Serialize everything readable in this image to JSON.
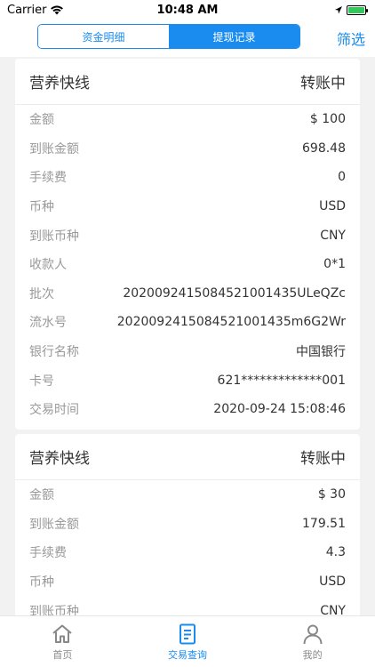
{
  "status_bar": {
    "carrier": "Carrier",
    "time": "10:48 AM"
  },
  "header": {
    "tabs": [
      {
        "label": "资金明细",
        "active": false
      },
      {
        "label": "提现记录",
        "active": true
      }
    ],
    "filter_label": "筛选"
  },
  "records": [
    {
      "title": "营养快线",
      "status": "转账中",
      "fields": [
        {
          "key": "金额",
          "value": "$ 100"
        },
        {
          "key": "到账金额",
          "value": "698.48"
        },
        {
          "key": "手续费",
          "value": "0"
        },
        {
          "key": "币种",
          "value": "USD"
        },
        {
          "key": "到账币种",
          "value": "CNY"
        },
        {
          "key": "收款人",
          "value": "0*1"
        },
        {
          "key": "批次",
          "value": "2020092415084521001435ULeQZc"
        },
        {
          "key": "流水号",
          "value": "2020092415084521001435m6G2Wr"
        },
        {
          "key": "银行名称",
          "value": "中国银行"
        },
        {
          "key": "卡号",
          "value": "621*************001"
        },
        {
          "key": "交易时间",
          "value": "2020-09-24 15:08:46"
        }
      ]
    },
    {
      "title": "营养快线",
      "status": "转账中",
      "fields": [
        {
          "key": "金额",
          "value": "$ 30"
        },
        {
          "key": "到账金额",
          "value": "179.51"
        },
        {
          "key": "手续费",
          "value": "4.3"
        },
        {
          "key": "币种",
          "value": "USD"
        },
        {
          "key": "到账币种",
          "value": "CNY"
        }
      ]
    }
  ],
  "tabbar": {
    "items": [
      {
        "label": "首页",
        "icon": "home-icon",
        "active": false
      },
      {
        "label": "交易查询",
        "icon": "document-icon",
        "active": true
      },
      {
        "label": "我的",
        "icon": "person-icon",
        "active": false
      }
    ]
  },
  "colors": {
    "accent": "#1a8cf0",
    "background": "#f2f2f2",
    "battery": "#34c759"
  }
}
